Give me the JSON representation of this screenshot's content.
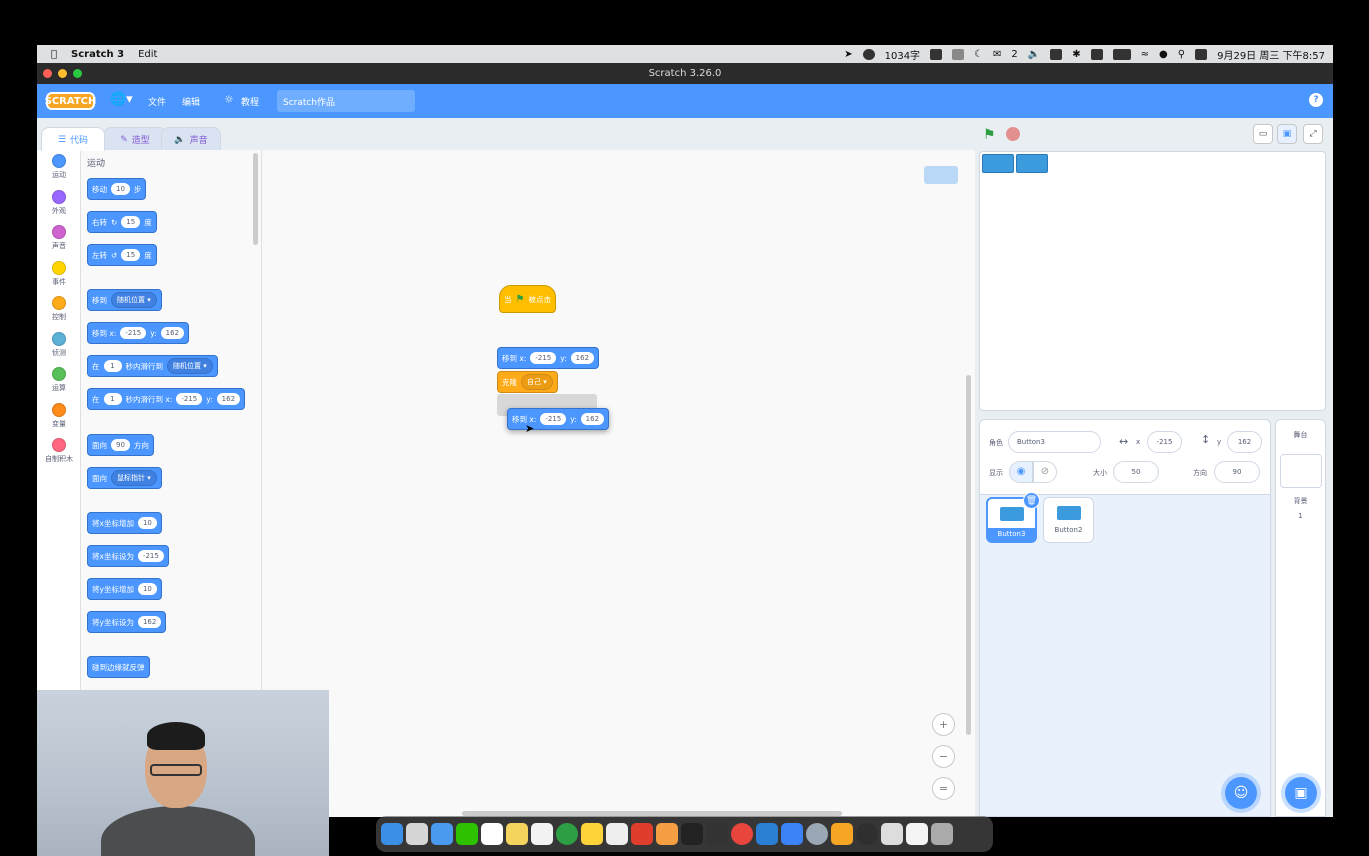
{
  "menubar": {
    "apple": "",
    "app": "Scratch 3",
    "edit": "Edit",
    "word_count": "1034字",
    "wechat_count": "2",
    "datetime": "9月29日 周三 下午8:57"
  },
  "window": {
    "title": "Scratch 3.26.0"
  },
  "scratch_menu": {
    "logo": "SCRATCH",
    "file": "文件",
    "edit": "编辑",
    "tutorials": "教程",
    "project_title": "Scratch作品",
    "help": "?"
  },
  "tabs": {
    "code": "代码",
    "costumes": "造型",
    "sounds": "声音"
  },
  "categories": [
    {
      "label": "运动",
      "color": "#4c97ff"
    },
    {
      "label": "外观",
      "color": "#9966ff"
    },
    {
      "label": "声音",
      "color": "#cf63cf"
    },
    {
      "label": "事件",
      "color": "#ffd500"
    },
    {
      "label": "控制",
      "color": "#ffab19"
    },
    {
      "label": "侦测",
      "color": "#5cb1d6"
    },
    {
      "label": "运算",
      "color": "#59c059"
    },
    {
      "label": "变量",
      "color": "#ff8c1a"
    },
    {
      "label": "自制积木",
      "color": "#ff6680"
    }
  ],
  "palette": {
    "title": "运动",
    "move": {
      "a": "移动",
      "v": "10",
      "b": "步"
    },
    "turn_right": {
      "a": "右转",
      "v": "15",
      "b": "度"
    },
    "turn_left": {
      "a": "左转",
      "v": "15",
      "b": "度"
    },
    "goto": {
      "a": "移到",
      "dd": "随机位置"
    },
    "goto_xy": {
      "a": "移到 x:",
      "x": "-215",
      "b": "y:",
      "y": "162"
    },
    "glide": {
      "a": "在",
      "v": "1",
      "b": "秒内滑行到",
      "dd": "随机位置"
    },
    "glide_xy": {
      "a": "在",
      "v": "1",
      "b": "秒内滑行到 x:",
      "x": "-215",
      "c": "y:",
      "y": "162"
    },
    "point_dir": {
      "a": "面向",
      "v": "90",
      "b": "方向"
    },
    "point_towards": {
      "a": "面向",
      "dd": "鼠标指针"
    },
    "change_x": {
      "a": "将x坐标增加",
      "v": "10"
    },
    "set_x": {
      "a": "将x坐标设为",
      "v": "-215"
    },
    "change_y": {
      "a": "将y坐标增加",
      "v": "10"
    },
    "set_y": {
      "a": "将y坐标设为",
      "v": "162"
    },
    "bounce": {
      "a": "碰到边缘就反弹"
    }
  },
  "script": {
    "hat": {
      "a": "当",
      "b": "被点击"
    },
    "goto": {
      "a": "移到 x:",
      "x": "-215",
      "b": "y:",
      "y": "162"
    },
    "clone": {
      "a": "克隆",
      "dd": "自己"
    },
    "dragging": {
      "a": "移到 x:",
      "x": "-215",
      "b": "y:",
      "y": "162"
    }
  },
  "zoom": {
    "in": "+",
    "out": "−",
    "reset": "="
  },
  "sprite_info": {
    "sprite_label": "角色",
    "sprite_name": "Button3",
    "x_label": "x",
    "x_value": "-215",
    "y_label": "y",
    "y_value": "162",
    "show_label": "显示",
    "size_label": "大小",
    "size_value": "50",
    "direction_label": "方向",
    "direction_value": "90"
  },
  "sprites": [
    {
      "name": "Button3",
      "selected": true
    },
    {
      "name": "Button2",
      "selected": false
    }
  ],
  "stage_panel": {
    "title": "舞台",
    "backdrop_label": "背景",
    "backdrop_count": "1"
  }
}
